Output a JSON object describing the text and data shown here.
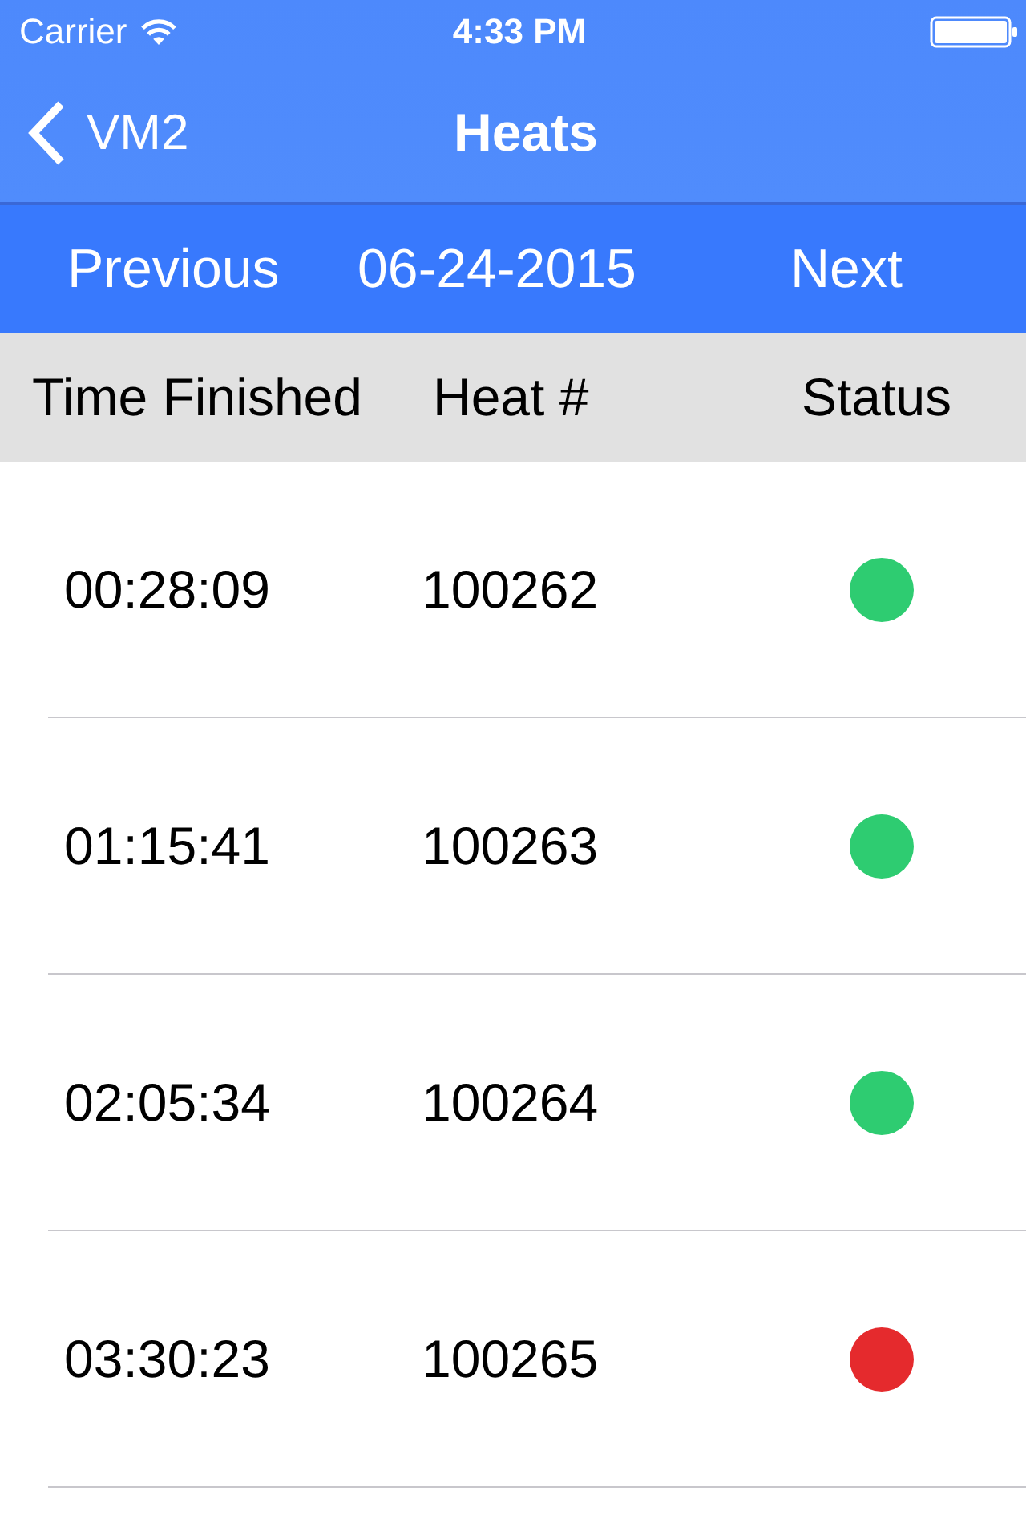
{
  "status_bar": {
    "carrier": "Carrier",
    "time": "4:33 PM"
  },
  "nav_bar": {
    "back_label": "VM2",
    "title": "Heats"
  },
  "date_bar": {
    "previous": "Previous",
    "date": "06-24-2015",
    "next": "Next"
  },
  "table": {
    "columns": [
      "Time Finished",
      "Heat #",
      "Status"
    ],
    "rows": [
      {
        "time_finished": "00:28:09",
        "heat": "100262",
        "color": "#2ecc71"
      },
      {
        "time_finished": "01:15:41",
        "heat": "100263",
        "color": "#2ecc71"
      },
      {
        "time_finished": "02:05:34",
        "heat": "100264",
        "color": "#2ecc71"
      },
      {
        "time_finished": "03:30:23",
        "heat": "100265",
        "color": "#e52a2d"
      }
    ]
  }
}
